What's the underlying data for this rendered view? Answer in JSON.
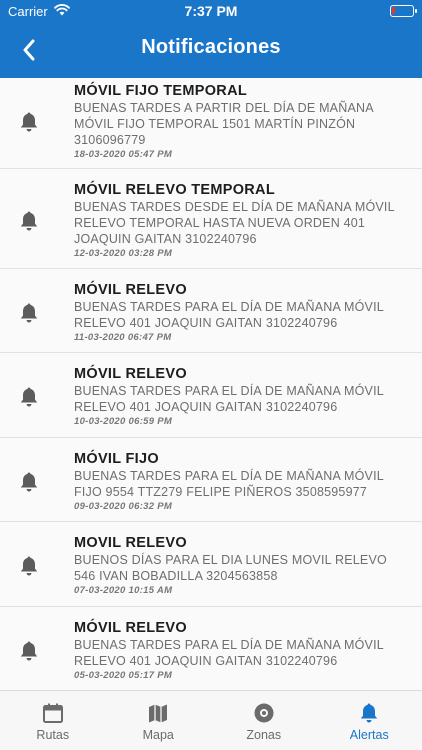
{
  "status_bar": {
    "carrier": "Carrier",
    "time": "7:37 PM"
  },
  "header": {
    "title": "Notificaciones",
    "back_icon": "chevron-left-icon"
  },
  "colors": {
    "brand": "#1a76c9",
    "bell": "#5c5c5c",
    "battery_low": "#e53935"
  },
  "notifications": [
    {
      "title": "MÓVIL FIJO TEMPORAL",
      "body": [
        "BUENAS TARDES A PARTIR DEL DÍA DE MAÑANA",
        "MÓVIL FIJO TEMPORAL 1501 MARTÍN PINZÓN",
        "3106096779"
      ],
      "date": "18-03-2020 05:47 PM"
    },
    {
      "title": "MÓVIL RELEVO TEMPORAL",
      "body": [
        "BUENAS TARDES DESDE EL  DÍA DE MAÑANA MÓVIL",
        "RELEVO TEMPORAL HASTA NUEVA ORDEN  401",
        "JOAQUIN GAITAN 3102240796"
      ],
      "date": "12-03-2020 03:28 PM"
    },
    {
      "title": "MÓVIL RELEVO",
      "body": [
        "BUENAS TARDES PARA EL DÍA DE MAÑANA MÓVIL",
        "RELEVO 401 JOAQUIN GAITAN 3102240796"
      ],
      "date": "11-03-2020 06:47 PM"
    },
    {
      "title": "MÓVIL RELEVO",
      "body": [
        "BUENAS TARDES PARA EL DÍA DE MAÑANA MÓVIL",
        "RELEVO 401 JOAQUIN GAITAN 3102240796"
      ],
      "date": "10-03-2020 06:59 PM"
    },
    {
      "title": "MÓVIL FIJO",
      "body": [
        "BUENAS TARDES PARA EL DÍA DE MAÑANA MÓVIL",
        "FIJO 9554 TTZ279 FELIPE PIÑEROS 3508595977"
      ],
      "date": "09-03-2020 06:32 PM"
    },
    {
      "title": "MOVIL RELEVO",
      "body": [
        "BUENOS DÍAS PARA EL DIA LUNES MOVIL RELEVO",
        "546 IVAN BOBADILLA 3204563858"
      ],
      "date": "07-03-2020 10:15 AM"
    },
    {
      "title": "MÓVIL RELEVO",
      "body": [
        "BUENAS TARDES PARA EL DÍA DE MAÑANA MÓVIL",
        "RELEVO 401 JOAQUIN GAITAN 3102240796"
      ],
      "date": "05-03-2020 05:17 PM"
    }
  ],
  "tabs": [
    {
      "label": "Rutas",
      "icon": "calendar-icon",
      "active": false
    },
    {
      "label": "Mapa",
      "icon": "map-icon",
      "active": false
    },
    {
      "label": "Zonas",
      "icon": "target-icon",
      "active": false
    },
    {
      "label": "Alertas",
      "icon": "bell-icon",
      "active": true
    }
  ]
}
